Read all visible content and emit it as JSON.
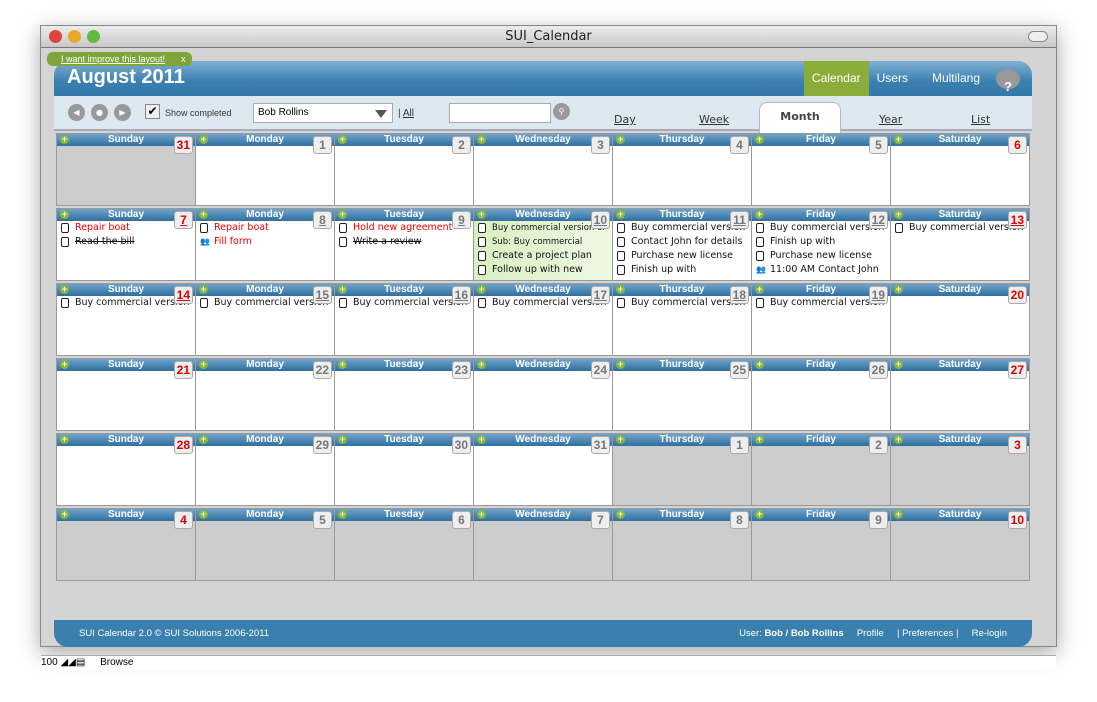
{
  "window": {
    "title": "SUI_Calendar"
  },
  "header": {
    "title": "August 2011",
    "improve_link": "I want improve this layout!",
    "improve_close": "x",
    "nav": [
      {
        "label": "Calendar",
        "active": true
      },
      {
        "label": "Users"
      },
      {
        "label": "Multilang"
      }
    ],
    "help": "?"
  },
  "toolbar": {
    "show_completed": "Show completed",
    "show_completed_checked": true,
    "user_select": "Bob Rollins",
    "all_sep": "|",
    "all_link": "All",
    "search_value": "",
    "tabs": [
      "Day",
      "Week",
      "Month",
      "Year",
      "List"
    ],
    "active_tab": "Month"
  },
  "day_names": [
    "Sunday",
    "Monday",
    "Tuesday",
    "Wednesday",
    "Thursday",
    "Friday",
    "Saturday"
  ],
  "weeks": [
    [
      {
        "n": "31",
        "other": true
      },
      {
        "n": "1"
      },
      {
        "n": "2"
      },
      {
        "n": "3"
      },
      {
        "n": "4"
      },
      {
        "n": "5"
      },
      {
        "n": "6"
      }
    ],
    [
      {
        "n": "7",
        "events": [
          {
            "t": "Repair boat",
            "s": "red"
          },
          {
            "t": "Read the bill",
            "s": "strike"
          }
        ]
      },
      {
        "n": "8",
        "events": [
          {
            "t": "Repair boat",
            "s": "red"
          },
          {
            "t": "Fill form",
            "s": "red",
            "icon": "people"
          }
        ]
      },
      {
        "n": "9",
        "events": [
          {
            "t": "Hold new agreement",
            "s": "red"
          },
          {
            "t": "Write a review",
            "s": "strike"
          }
        ]
      },
      {
        "n": "10",
        "hl": true,
        "events": [
          {
            "t": "Buy commercial version of",
            "s": "small"
          },
          {
            "t": "Sub: Buy commercial",
            "s": "small"
          },
          {
            "t": "Create a project plan"
          },
          {
            "t": "Follow up with new"
          }
        ]
      },
      {
        "n": "11",
        "events": [
          {
            "t": "Buy commercial version"
          },
          {
            "t": "Contact John for details"
          },
          {
            "t": "Purchase new license"
          },
          {
            "t": "Finish up with"
          }
        ]
      },
      {
        "n": "12",
        "events": [
          {
            "t": "Buy commercial version"
          },
          {
            "t": "Finish up with"
          },
          {
            "t": "Purchase new license"
          },
          {
            "t": "11:00 AM Contact John",
            "icon": "people"
          }
        ]
      },
      {
        "n": "13",
        "events": [
          {
            "t": "Buy commercial version"
          }
        ]
      }
    ],
    [
      {
        "n": "14",
        "events": [
          {
            "t": "Buy commercial version"
          }
        ]
      },
      {
        "n": "15",
        "events": [
          {
            "t": "Buy commercial version"
          }
        ]
      },
      {
        "n": "16",
        "events": [
          {
            "t": "Buy commercial version"
          }
        ]
      },
      {
        "n": "17",
        "events": [
          {
            "t": "Buy commercial version"
          }
        ]
      },
      {
        "n": "18",
        "events": [
          {
            "t": "Buy commercial version"
          }
        ]
      },
      {
        "n": "19",
        "events": [
          {
            "t": "Buy commercial version"
          }
        ]
      },
      {
        "n": "20"
      }
    ],
    [
      {
        "n": "21"
      },
      {
        "n": "22"
      },
      {
        "n": "23"
      },
      {
        "n": "24"
      },
      {
        "n": "25"
      },
      {
        "n": "26"
      },
      {
        "n": "27"
      }
    ],
    [
      {
        "n": "28"
      },
      {
        "n": "29"
      },
      {
        "n": "30"
      },
      {
        "n": "31"
      },
      {
        "n": "1",
        "other": true
      },
      {
        "n": "2",
        "other": true
      },
      {
        "n": "3",
        "other": true
      }
    ],
    [
      {
        "n": "4",
        "other": true
      },
      {
        "n": "5",
        "other": true
      },
      {
        "n": "6",
        "other": true
      },
      {
        "n": "7",
        "other": true
      },
      {
        "n": "8",
        "other": true
      },
      {
        "n": "9",
        "other": true
      },
      {
        "n": "10",
        "other": true
      }
    ]
  ],
  "footer": {
    "copyright": "SUI Calendar 2.0 © SUI Solutions 2006-2011",
    "user_label": "User:",
    "user_name": "Bob / Bob Rollins",
    "profile": "Profile",
    "preferences": "Preferences",
    "relogin": "Re-login",
    "sep": "|"
  },
  "statusbar": {
    "zoom": "100",
    "mode": "Browse"
  },
  "colors": {
    "header_blue": "#3a80ae",
    "active_nav": "#8aad3a",
    "weekend_number": "#dd0000",
    "event_red": "#ee0000"
  }
}
